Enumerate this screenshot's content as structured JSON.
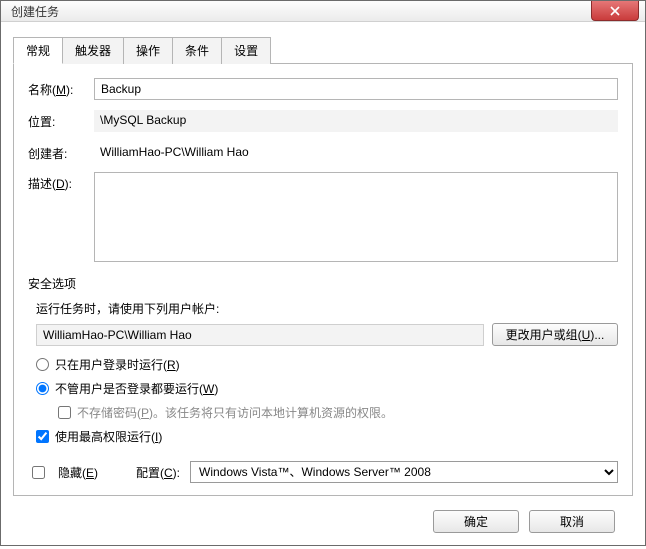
{
  "window": {
    "title": "创建任务"
  },
  "tabs": [
    {
      "label": "常规",
      "active": true
    },
    {
      "label": "触发器",
      "active": false
    },
    {
      "label": "操作",
      "active": false
    },
    {
      "label": "条件",
      "active": false
    },
    {
      "label": "设置",
      "active": false
    }
  ],
  "general": {
    "name_label_pre": "名称(",
    "name_key": "M",
    "name_label_post": "):",
    "name_value": "Backup",
    "location_label": "位置:",
    "location_value": "\\MySQL Backup",
    "author_label": "创建者:",
    "author_value": "WilliamHao-PC\\William Hao",
    "description_label_pre": "描述(",
    "description_key": "D",
    "description_label_post": "):",
    "description_value": ""
  },
  "security": {
    "section_title": "安全选项",
    "prompt": "运行任务时，请使用下列用户帐户:",
    "account": "WilliamHao-PC\\William Hao",
    "change_user_btn_pre": "更改用户或组(",
    "change_user_key": "U",
    "change_user_btn_post": ")...",
    "radio_logged_on_pre": "只在用户登录时运行(",
    "radio_logged_on_key": "R",
    "radio_logged_on_post": ")",
    "radio_any_pre": "不管用户是否登录都要运行(",
    "radio_any_key": "W",
    "radio_any_post": ")",
    "run_mode": "any",
    "no_store_pw_pre": "不存储密码(",
    "no_store_pw_key": "P",
    "no_store_pw_post": ")。该任务将只有访问本地计算机资源的权限。",
    "no_store_pw_checked": false,
    "highest_priv_pre": "使用最高权限运行(",
    "highest_priv_key": "I",
    "highest_priv_post": ")",
    "highest_priv_checked": true
  },
  "bottom": {
    "hidden_pre": "隐藏(",
    "hidden_key": "E",
    "hidden_post": ")",
    "hidden_checked": false,
    "config_label_pre": "配置(",
    "config_key": "C",
    "config_label_post": "):",
    "config_value": "Windows Vista™、Windows Server™ 2008"
  },
  "footer": {
    "ok": "确定",
    "cancel": "取消"
  }
}
